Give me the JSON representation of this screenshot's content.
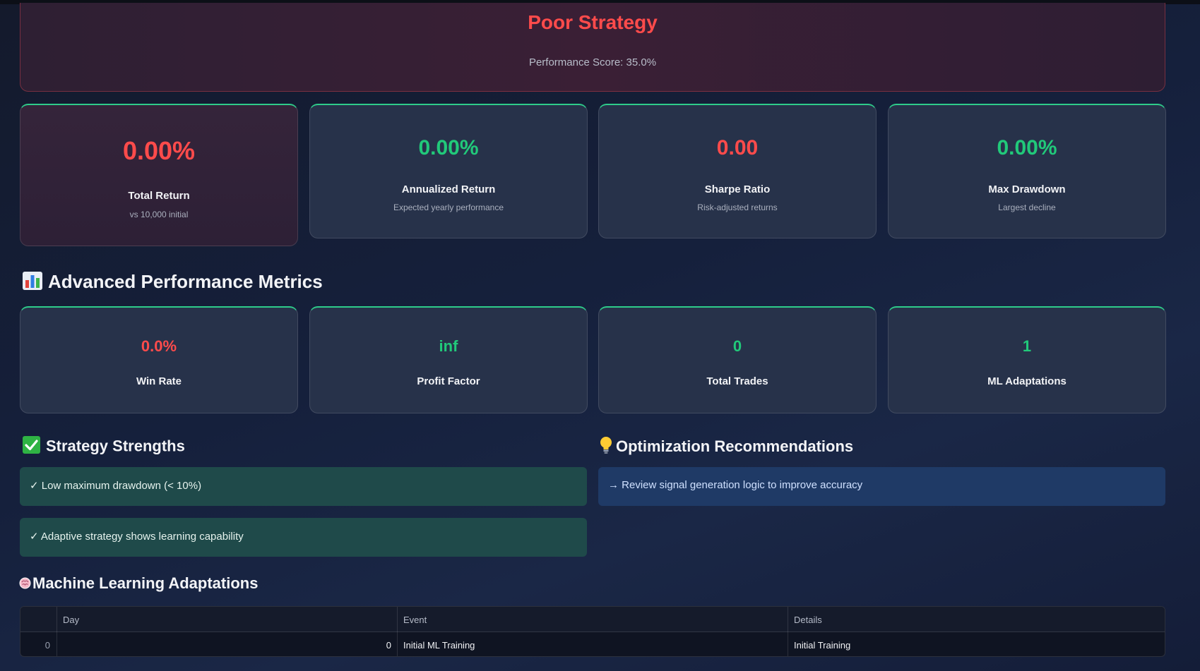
{
  "hero": {
    "title": "Poor Strategy",
    "score": "Performance Score: 35.0%"
  },
  "kpis": [
    {
      "value": "0.00%",
      "label": "Total Return",
      "sub": "vs 10,000 initial",
      "tone": "negative"
    },
    {
      "value": "0.00%",
      "label": "Annualized Return",
      "sub": "Expected yearly performance",
      "tone": "positive"
    },
    {
      "value": "0.00",
      "label": "Sharpe Ratio",
      "sub": "Risk-adjusted returns",
      "tone": "negative"
    },
    {
      "value": "0.00%",
      "label": "Max Drawdown",
      "sub": "Largest decline",
      "tone": "positive"
    }
  ],
  "advanced": {
    "title": "Advanced Performance Metrics",
    "icon": "bar-chart-icon",
    "metrics": [
      {
        "value": "0.0%",
        "label": "Win Rate",
        "tone": "negative"
      },
      {
        "value": "inf",
        "label": "Profit Factor",
        "tone": "positive"
      },
      {
        "value": "0",
        "label": "Total Trades",
        "tone": "positive"
      },
      {
        "value": "1",
        "label": "ML Adaptations",
        "tone": "positive"
      }
    ]
  },
  "strengths": {
    "title": "Strategy Strengths",
    "icon": "check-mark-icon",
    "items": [
      "✓ Low maximum drawdown (< 10%)",
      "✓ Adaptive strategy shows learning capability"
    ]
  },
  "recommendations": {
    "title": "Optimization Recommendations",
    "icon": "light-bulb-icon",
    "items": [
      "→ Review signal generation logic to improve accuracy"
    ]
  },
  "ml": {
    "title": "Machine Learning Adaptations",
    "icon": "brain-icon",
    "columns": [
      "",
      "Day",
      "Event",
      "Details"
    ],
    "rows": [
      {
        "index": "0",
        "day": "0",
        "event": "Initial ML Training",
        "details": "Initial Training"
      }
    ]
  },
  "colors": {
    "negative": "#ff4b4b",
    "positive": "#21c97a",
    "accent_border": "#2ecc8a"
  }
}
